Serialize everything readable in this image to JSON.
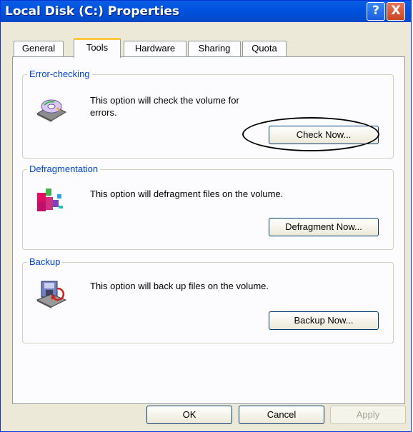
{
  "window": {
    "title": "Local Disk (C:) Properties"
  },
  "titlebar_buttons": {
    "help": "?",
    "close": "X"
  },
  "tabs": [
    {
      "label": "General"
    },
    {
      "label": "Tools"
    },
    {
      "label": "Hardware"
    },
    {
      "label": "Sharing"
    },
    {
      "label": "Quota"
    }
  ],
  "active_tab": "Tools",
  "sections": {
    "error_checking": {
      "title": "Error-checking",
      "text_line1": "This option will check the volume for",
      "text_line2": "errors.",
      "button": "Check Now..."
    },
    "defragmentation": {
      "title": "Defragmentation",
      "text": "This option will defragment files on the volume.",
      "button": "Defragment Now..."
    },
    "backup": {
      "title": "Backup",
      "text": "This option will back up files on the volume.",
      "button": "Backup Now..."
    }
  },
  "footer": {
    "ok": "OK",
    "cancel": "Cancel",
    "apply": "Apply"
  },
  "icons": {
    "error_checking": "disk-check-icon",
    "defragmentation": "defragment-icon",
    "backup": "backup-icon"
  },
  "colors": {
    "title_bar": "#0053e1",
    "group_title": "#0046d5",
    "active_tab_highlight": "#ffc83c"
  }
}
